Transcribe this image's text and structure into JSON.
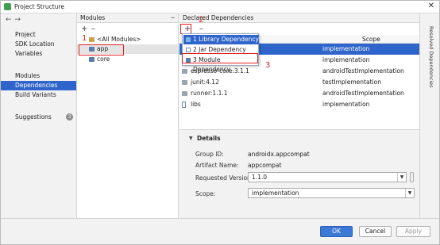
{
  "window": {
    "title": "Project Structure"
  },
  "sidebar": {
    "items": [
      {
        "label": "Project"
      },
      {
        "label": "SDK Location"
      },
      {
        "label": "Variables"
      },
      {
        "label": "Modules"
      },
      {
        "label": "Dependencies"
      },
      {
        "label": "Build Variants"
      },
      {
        "label": "Suggestions",
        "badge": "3"
      }
    ]
  },
  "modules": {
    "header": "Modules",
    "items": [
      {
        "label": "<All Modules>"
      },
      {
        "label": "app"
      },
      {
        "label": "core"
      }
    ]
  },
  "dependencies": {
    "header": "Declared Dependencies",
    "scope_header": "Scope",
    "rows": [
      {
        "name": "",
        "scope": "implementation"
      },
      {
        "name": "",
        "scope": "implementation"
      },
      {
        "name": "espresso-core:3.1.1",
        "scope": "androidTestImplementation"
      },
      {
        "name": "junit:4.12",
        "scope": "testImplementation"
      },
      {
        "name": "runner:1.1.1",
        "scope": "androidTestImplementation"
      },
      {
        "name": "libs",
        "scope": "implementation"
      }
    ],
    "popup": [
      {
        "label": "1  Library Dependency"
      },
      {
        "label": "2  Jar Dependency"
      },
      {
        "label": "3  Module Dependency"
      }
    ]
  },
  "details": {
    "title": "Details",
    "group_id_label": "Group ID:",
    "group_id": "androidx.appcompat",
    "artifact_label": "Artifact Name:",
    "artifact": "appcompat",
    "version_label": "Requested Version:",
    "version": "1.1.0",
    "scope_label": "Scope:",
    "scope": "implementation"
  },
  "right_strip": {
    "label": "Resolved Dependencies"
  },
  "annotations": [
    "1",
    "2",
    "3"
  ],
  "footer": {
    "ok": "OK",
    "cancel": "Cancel",
    "apply": "Apply"
  }
}
